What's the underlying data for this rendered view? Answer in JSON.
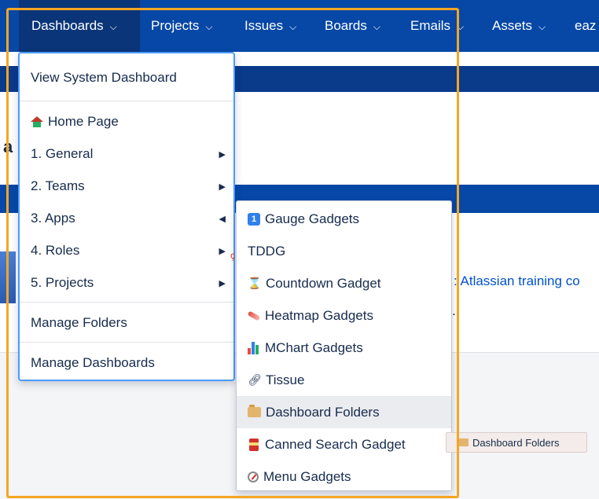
{
  "nav": {
    "items": [
      {
        "label": "Dashboards",
        "chevron": "chevron-down-icon"
      },
      {
        "label": "Projects",
        "chevron": "chevron-down-icon"
      },
      {
        "label": "Issues",
        "chevron": "chevron-down-icon"
      },
      {
        "label": "Boards",
        "chevron": "chevron-down-icon"
      },
      {
        "label": "Emails",
        "chevron": "chevron-down-icon"
      },
      {
        "label": "Assets",
        "chevron": "chevron-down-icon"
      },
      {
        "label": "eaz"
      }
    ]
  },
  "page": {
    "title_fragment": "a",
    "link_fragment": ": Atlassian training co",
    "dot_fragment": "."
  },
  "dashboards_menu": {
    "view_system": "View System Dashboard",
    "home_page": "Home Page",
    "groups": [
      {
        "label": "1. General",
        "arrow": "right"
      },
      {
        "label": "2. Teams",
        "arrow": "right"
      },
      {
        "label": "3. Apps",
        "arrow": "left"
      },
      {
        "label": "4. Roles",
        "arrow": "right"
      },
      {
        "label": "5. Projects",
        "arrow": "right"
      }
    ],
    "manage_folders": "Manage Folders",
    "manage_dashboards": "Manage Dashboards"
  },
  "apps_submenu": {
    "items": [
      {
        "label": "Gauge Gadgets",
        "icon": "gauge-icon"
      },
      {
        "label": "TDDG",
        "icon": ""
      },
      {
        "label": "Countdown Gadget",
        "icon": "hourglass-icon"
      },
      {
        "label": "Heatmap Gadgets",
        "icon": "heatmap-icon"
      },
      {
        "label": "MChart Gadgets",
        "icon": "bar-chart-icon"
      },
      {
        "label": "Tissue",
        "icon": "link-icon"
      },
      {
        "label": "Dashboard Folders",
        "icon": "folder-icon"
      },
      {
        "label": "Canned Search Gadget",
        "icon": "can-icon"
      },
      {
        "label": "Menu Gadgets",
        "icon": "compass-icon"
      }
    ]
  },
  "drag_tooltip": {
    "label": "Dashboard Folders"
  },
  "colors": {
    "nav_bg": "#0747a6",
    "nav_active_bg": "#0a3578",
    "menu_border": "#4c9aff",
    "highlight_frame": "#f5a623",
    "link": "#0052cc"
  }
}
